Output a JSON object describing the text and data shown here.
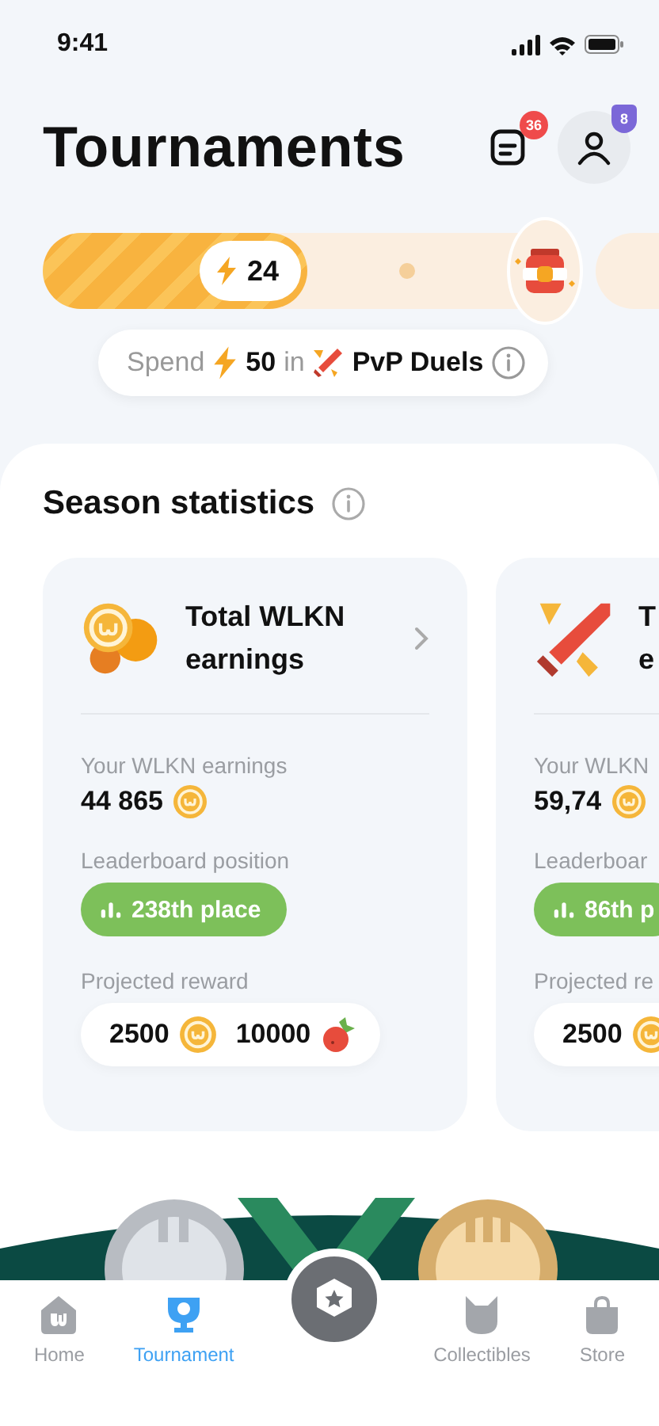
{
  "status_bar": {
    "time": "9:41"
  },
  "header": {
    "title": "Tournaments",
    "notifications_count": "36",
    "level_badge": "8"
  },
  "progress": {
    "value": "24"
  },
  "quest": {
    "prefix": "Spend",
    "amount": "50",
    "connector": "in",
    "mode": "PvP Duels"
  },
  "season": {
    "title": "Season statistics",
    "cards": [
      {
        "kind": "coins",
        "title_lines": [
          "Total WLKN",
          "earnings"
        ],
        "earnings_label": "Your WLKN earnings",
        "earnings": "44 865",
        "position_label": "Leaderboard position",
        "position": "238th place",
        "reward_label": "Projected reward",
        "rewards": [
          {
            "kind": "coin",
            "amount": "2500"
          },
          {
            "kind": "berry",
            "amount": "10000"
          }
        ]
      },
      {
        "kind": "duel",
        "title_lines": [
          "T",
          "e"
        ],
        "earnings_label": "Your WLKN",
        "earnings": "59,74",
        "position_label": "Leaderboar",
        "position": "86th p",
        "reward_label": "Projected re",
        "rewards": [
          {
            "kind": "coin",
            "amount": "2500"
          }
        ]
      }
    ]
  },
  "nav": [
    {
      "kind": "home",
      "label": "Home",
      "selected": false
    },
    {
      "kind": "trophy",
      "label": "Tournament",
      "selected": true
    },
    {
      "kind": "center"
    },
    {
      "kind": "cat",
      "label": "Collectibles",
      "selected": false
    },
    {
      "kind": "bag",
      "label": "Store",
      "selected": false
    }
  ]
}
